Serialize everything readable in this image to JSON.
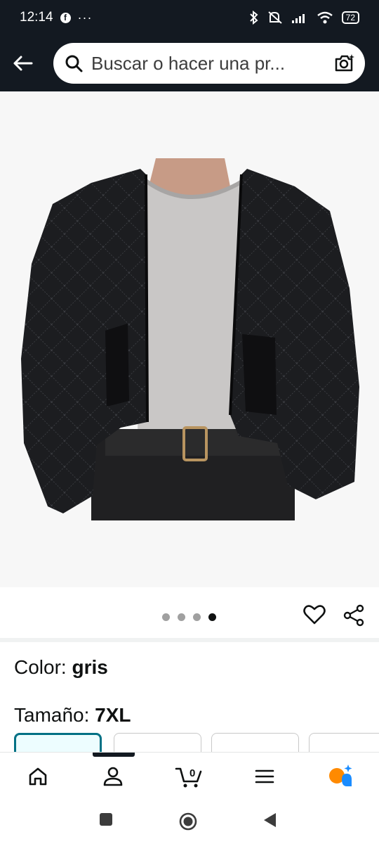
{
  "status_bar": {
    "time": "12:14",
    "more": "···",
    "battery": "72"
  },
  "header": {
    "search_placeholder": "Buscar o hacer una pr..."
  },
  "gallery": {
    "image_alt": "Chaqueta acolchada negra",
    "page_count": 4,
    "active_page": 4
  },
  "product": {
    "color_label": "Color: ",
    "color_value": "gris",
    "size_label": "Tamaño: ",
    "size_value": "7XL"
  },
  "bottom_nav": {
    "cart_count": "0",
    "items": [
      "home-icon",
      "account-icon",
      "cart-icon",
      "menu-icon",
      "ai-assistant-icon"
    ]
  },
  "colors": {
    "header_bg": "#131921",
    "selected_border": "#007185",
    "ai_orange": "#ff8a00",
    "ai_blue": "#1a8cff"
  }
}
